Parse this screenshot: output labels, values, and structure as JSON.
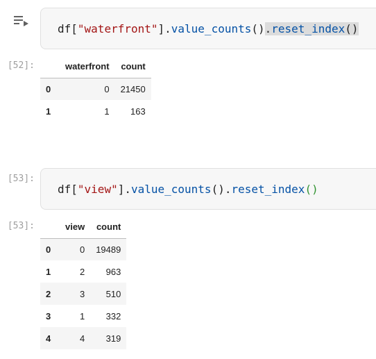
{
  "cells": [
    {
      "out_prompt": "[52]:",
      "code": {
        "prefix": "df[",
        "string": "\"waterfront\"",
        "mid": "].",
        "method1": "value_counts",
        "paren1": "()",
        "selected_dot": ".",
        "selected_method": "reset_index",
        "selected_paren": "()"
      },
      "output": {
        "columns": [
          "",
          "waterfront",
          "count"
        ],
        "rows": [
          {
            "index": "0",
            "values": [
              "0",
              "21450"
            ]
          },
          {
            "index": "1",
            "values": [
              "1",
              "163"
            ]
          }
        ]
      }
    },
    {
      "in_prompt": "[53]:",
      "out_prompt": "[53]:",
      "code": {
        "prefix": "df[",
        "string": "\"view\"",
        "mid": "].",
        "method1": "value_counts",
        "paren1": "()",
        "dot2": ".",
        "method2": "reset_index",
        "paren2": "()"
      },
      "output": {
        "columns": [
          "",
          "view",
          "count"
        ],
        "rows": [
          {
            "index": "0",
            "values": [
              "0",
              "19489"
            ]
          },
          {
            "index": "1",
            "values": [
              "2",
              "963"
            ]
          },
          {
            "index": "2",
            "values": [
              "3",
              "510"
            ]
          },
          {
            "index": "3",
            "values": [
              "1",
              "332"
            ]
          },
          {
            "index": "4",
            "values": [
              "4",
              "319"
            ]
          }
        ]
      }
    }
  ]
}
